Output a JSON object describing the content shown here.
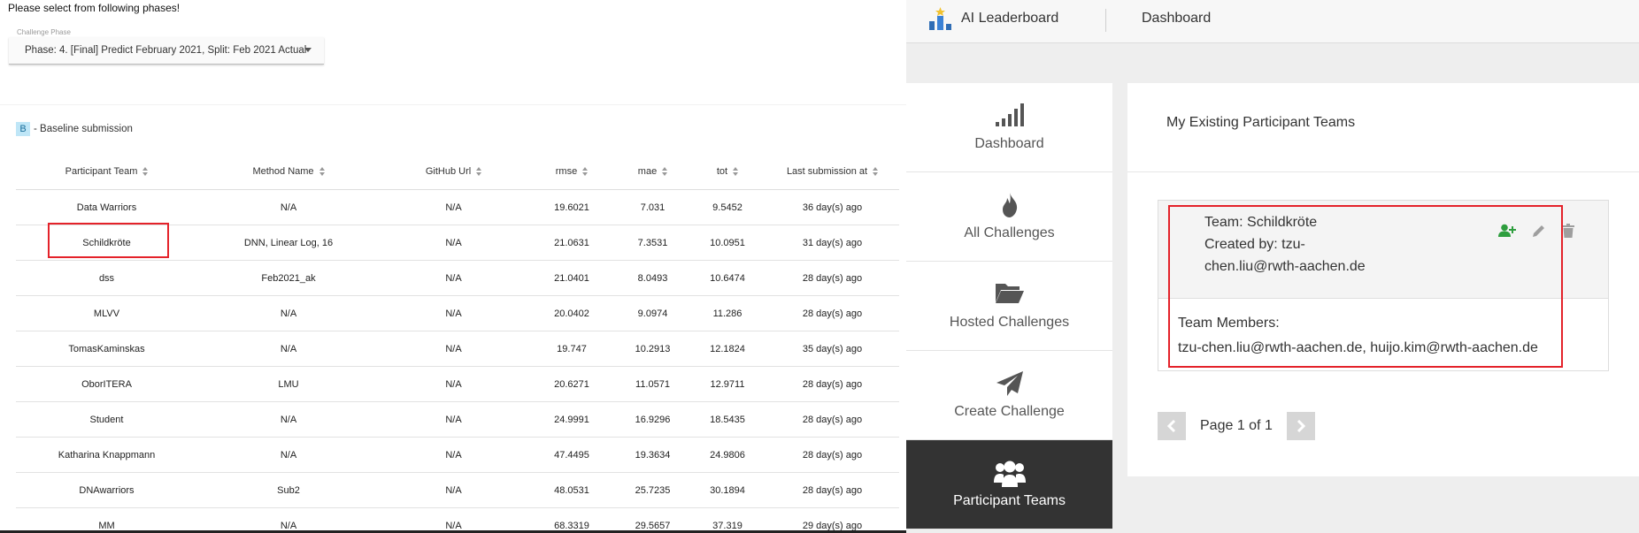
{
  "left": {
    "prompt": "Please select from following phases!",
    "phase_label": "Challenge Phase",
    "phase_value": "Phase: 4. [Final] Predict February 2021, Split: Feb 2021 Actual",
    "baseline_badge": "B",
    "baseline_text": "- Baseline submission",
    "columns": [
      "Participant Team",
      "Method Name",
      "GitHub Url",
      "rmse",
      "mae",
      "tot",
      "Last submission at"
    ],
    "rows": [
      [
        "Data Warriors",
        "N/A",
        "N/A",
        "19.6021",
        "7.031",
        "9.5452",
        "36 day(s) ago"
      ],
      [
        "Schildkröte",
        "DNN, Linear Log, 16",
        "N/A",
        "21.0631",
        "7.3531",
        "10.0951",
        "31 day(s) ago"
      ],
      [
        "dss",
        "Feb2021_ak",
        "N/A",
        "21.0401",
        "8.0493",
        "10.6474",
        "28 day(s) ago"
      ],
      [
        "MLVV",
        "N/A",
        "N/A",
        "20.0402",
        "9.0974",
        "11.286",
        "28 day(s) ago"
      ],
      [
        "TomasKaminskas",
        "N/A",
        "N/A",
        "19.747",
        "10.2913",
        "12.1824",
        "35 day(s) ago"
      ],
      [
        "OborITERA",
        "LMU",
        "N/A",
        "20.6271",
        "11.0571",
        "12.9711",
        "28 day(s) ago"
      ],
      [
        "Student",
        "N/A",
        "N/A",
        "24.9991",
        "16.9296",
        "18.5435",
        "28 day(s) ago"
      ],
      [
        "Katharina Knappmann",
        "N/A",
        "N/A",
        "47.4495",
        "19.3634",
        "24.9806",
        "28 day(s) ago"
      ],
      [
        "DNAwarriors",
        "Sub2",
        "N/A",
        "48.0531",
        "25.7235",
        "30.1894",
        "28 day(s) ago"
      ],
      [
        "MM",
        "N/A",
        "N/A",
        "68.3319",
        "29.5657",
        "37.319",
        "29 day(s) ago"
      ]
    ]
  },
  "right": {
    "brand": "AI Leaderboard",
    "top_nav": "Dashboard",
    "sidebar": [
      {
        "label": "Dashboard",
        "icon": "signal-bars-icon",
        "active": false
      },
      {
        "label": "All Challenges",
        "icon": "flame-icon",
        "active": false
      },
      {
        "label": "Hosted Challenges",
        "icon": "folder-open-icon",
        "active": false
      },
      {
        "label": "Create Challenge",
        "icon": "paper-plane-icon",
        "active": false
      },
      {
        "label": "Participant Teams",
        "icon": "users-icon",
        "active": true
      }
    ],
    "main_title": "My Existing Participant Teams",
    "team": {
      "name_line": "Team: Schildkröte",
      "created_line": "Created by: tzu-chen.liu@rwth-aachen.de",
      "members_label": "Team Members:",
      "members": "tzu-chen.liu@rwth-aachen.de, huijo.kim@rwth-aachen.de"
    },
    "pager_text": "Page 1 of 1",
    "colors": {
      "active_bg": "#333333",
      "add_icon": "#2e9e3e",
      "highlight": "#e4222a"
    }
  }
}
